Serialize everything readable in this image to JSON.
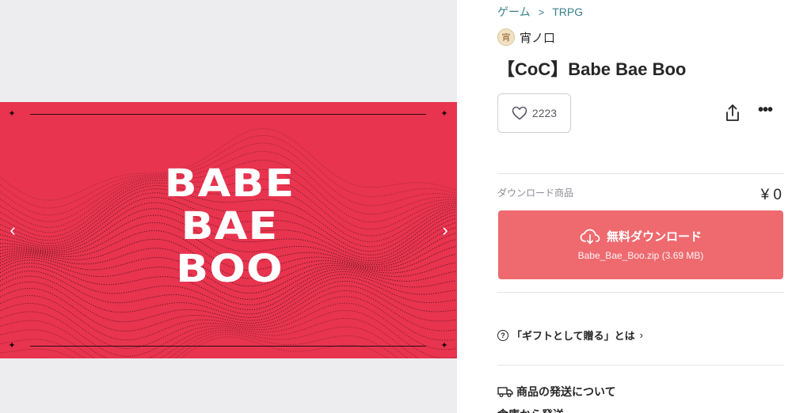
{
  "breadcrumb": {
    "items": [
      "ゲーム",
      "TRPG"
    ],
    "separator": ">"
  },
  "shop": {
    "name": "宵ノ口",
    "avatar_icon": "shop-avatar-icon"
  },
  "product": {
    "title": "【CoC】Babe Bae Boo",
    "likes": "2223",
    "type_label": "ダウンロード商品",
    "price": "¥ 0"
  },
  "banner": {
    "logo_lines": [
      "BABE",
      "BAE",
      "BOO"
    ],
    "background": "#e8344f",
    "prev_arrow": "‹",
    "next_arrow": "›"
  },
  "download": {
    "label": "無料ダウンロード",
    "file": "Babe_Bae_Boo.zip (3.69 MB)",
    "color": "#ee6a6f"
  },
  "gift": {
    "label": "「ギフトとして贈る」とは"
  },
  "shipping": {
    "heading": "商品の発送について",
    "next": "倉庫から発送"
  },
  "colors": {
    "link": "#3a7f8c",
    "text": "#262626",
    "muted": "#8a8a95",
    "border": "#cfcfd4"
  }
}
